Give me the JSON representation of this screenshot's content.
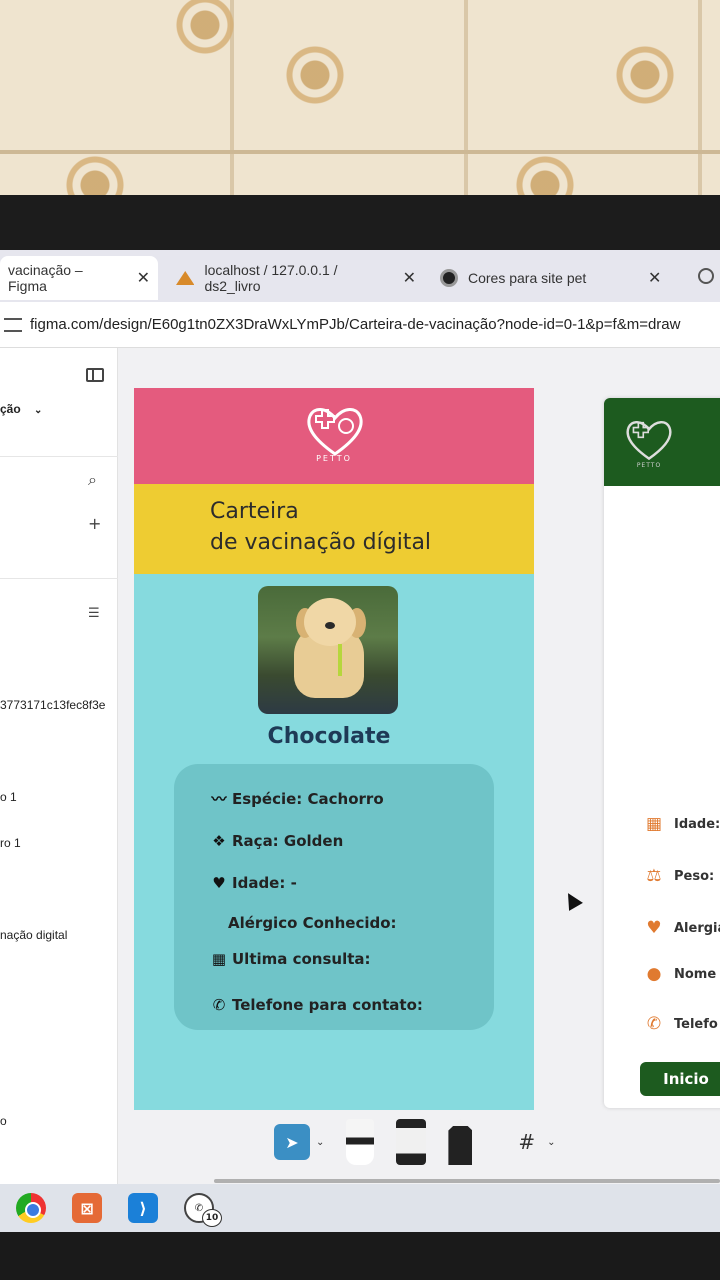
{
  "browser": {
    "tabs": [
      {
        "label": "vacinação – Figma",
        "close": "✕"
      },
      {
        "label": "localhost / 127.0.0.1 / ds2_livro",
        "close": "✕"
      },
      {
        "label": "Cores para site pet",
        "close": "✕"
      }
    ],
    "url": "figma.com/design/E60g1tn0ZX3DraWxLYmPJb/Carteira-de-vacinação?node-id=0-1&p=f&m=draw"
  },
  "left_panel": {
    "file_label": "ção",
    "hash": "3773171c13fec8f3e",
    "item_1": "o 1",
    "item_2": "ro 1",
    "item_3": "nação digital",
    "item_4": "o"
  },
  "card": {
    "logo_text": "PETTO",
    "title_line1": "Carteira",
    "title_line2": "de vacinação dígital",
    "pet_name": "Chocolate",
    "info": {
      "especie": "Espécie: Cachorro",
      "raca": "Raça: Golden",
      "idade": "Idade: -",
      "alergico": "Alérgico Conhecido:",
      "consulta": "Ultima consulta:",
      "telefone": "Telefone para contato:"
    }
  },
  "card2": {
    "logo_text": "PETTO",
    "rows": {
      "idade": "Idade:",
      "peso": "Peso:",
      "alergia": "Alergia",
      "nome": "Nome",
      "telefone": "Telefo"
    },
    "button": "Inicio"
  },
  "taskbar": {
    "whatsapp_badge": "10"
  },
  "colors": {
    "header_pink": "#e45b7e",
    "title_yellow": "#eecc32",
    "body_cyan": "#86dade",
    "info_box": "#6fc4c8",
    "pet_name": "#1e3a56",
    "card2_green": "#1d5b1f",
    "accent_orange": "#e07a30"
  }
}
